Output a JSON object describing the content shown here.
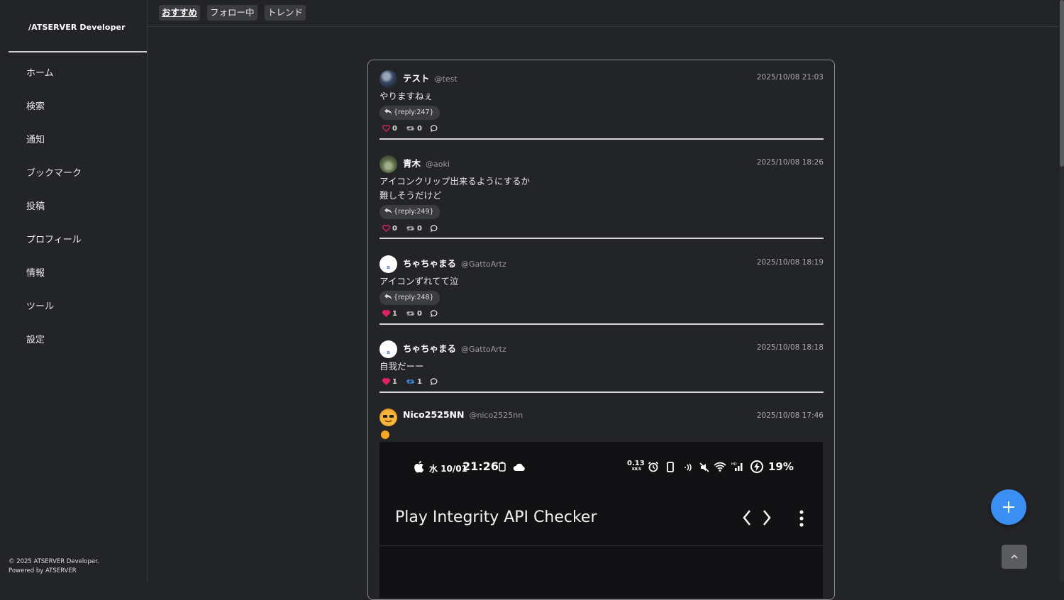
{
  "brand": "/ATSERVER Developer",
  "nav": [
    "ホーム",
    "検索",
    "通知",
    "ブックマーク",
    "投稿",
    "プロフィール",
    "情報",
    "ツール",
    "設定"
  ],
  "footer": {
    "line1": "© 2025 ATSERVER Developer.",
    "line2": "Powered by ATSERVER"
  },
  "tabs": [
    "おすすめ",
    "フォロー中",
    "トレンド"
  ],
  "posts": [
    {
      "name": "テスト",
      "handle": "@test",
      "time": "2025/10/08 21:03",
      "text": "やりますねぇ",
      "reply": "{reply:247}",
      "likes": "0",
      "reposts": "0",
      "liked": false,
      "reposted": false
    },
    {
      "name": "青木",
      "handle": "@aoki",
      "time": "2025/10/08 18:26",
      "text": "アイコンクリップ出来るようにするか\n難しそうだけど",
      "reply": "{reply:249}",
      "likes": "0",
      "reposts": "0",
      "liked": false,
      "reposted": false
    },
    {
      "name": "ちゃちゃまる",
      "handle": "@GattoArtz",
      "time": "2025/10/08 18:19",
      "text": "アイコンずれてて泣",
      "reply": "{reply:248}",
      "likes": "1",
      "reposts": "0",
      "liked": true,
      "reposted": false
    },
    {
      "name": "ちゃちゃまる",
      "handle": "@GattoArtz",
      "time": "2025/10/08 18:18",
      "text": "自我だーー",
      "reply": "",
      "likes": "1",
      "reposts": "1",
      "liked": true,
      "reposted": true
    },
    {
      "name": "Nico2525NN",
      "handle": "@nico2525nn",
      "time": "2025/10/08 17:46",
      "text": "",
      "reply": "",
      "likes": "",
      "reposts": "",
      "liked": false,
      "reposted": false
    }
  ],
  "embed": {
    "date": "水 10/01",
    "clock": "21:26",
    "net_speed": "0.13",
    "net_unit": "KB/S",
    "battery": "19%",
    "app_title": "Play Integrity API Checker"
  },
  "colors": {
    "accent": "#3b8ff2",
    "like": "#e0245e",
    "repost": "#3b8ff2",
    "background": "#232427"
  }
}
